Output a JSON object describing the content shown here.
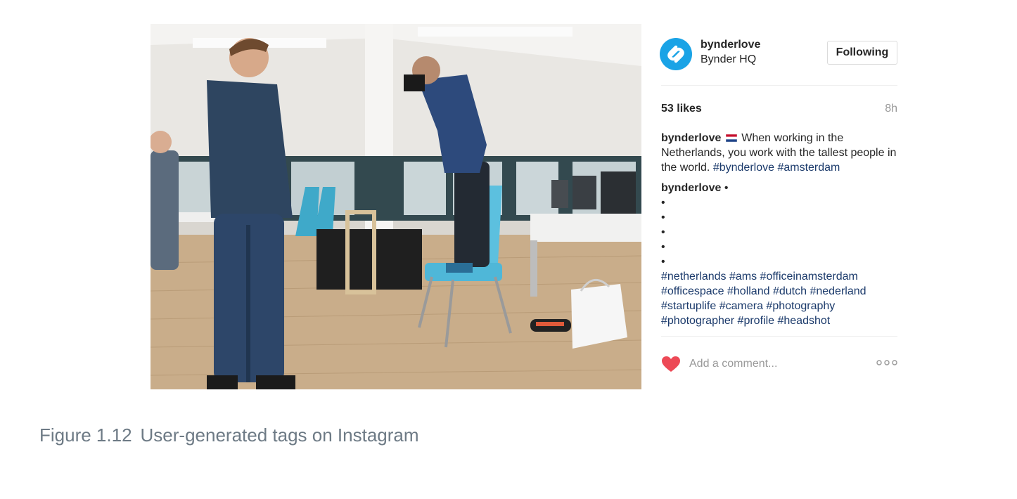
{
  "post": {
    "photo_alt": "",
    "author": {
      "username": "bynderlove",
      "location": "Bynder HQ"
    },
    "follow_label": "Following",
    "likes": "53 likes",
    "time": "8h",
    "caption": {
      "username": "bynderlove",
      "flag": "Netherlands flag",
      "text": "When working in the Netherlands, you work with the tallest people in the world.",
      "tags": [
        "#bynderlove",
        "#amsterdam"
      ]
    },
    "first_comment": {
      "username": "bynderlove",
      "text": "•",
      "bullets": [
        "•",
        "•",
        "•",
        "•",
        "•"
      ],
      "tags_line1": [
        "#netherlands",
        "#ams",
        "#officeinamsterdam"
      ],
      "tags_line2": [
        "#officespace",
        "#holland",
        "#dutch",
        "#nederland"
      ],
      "tags_line3": [
        "#startuplife",
        "#camera",
        "#photography"
      ],
      "tags_line4": [
        "#photographer",
        "#profile",
        "#headshot"
      ]
    },
    "comment_placeholder": "Add a comment...",
    "icons": {
      "avatar": "bynder-logo-icon",
      "heart": "heart-icon",
      "more": "more-options-icon"
    },
    "colors": {
      "heart": "#ed4956",
      "avatar": "#1aa3e6",
      "hashtag": "#1b3a6b"
    }
  },
  "figure": {
    "number": "Figure 1.12",
    "caption": "User-generated tags on Instagram"
  }
}
